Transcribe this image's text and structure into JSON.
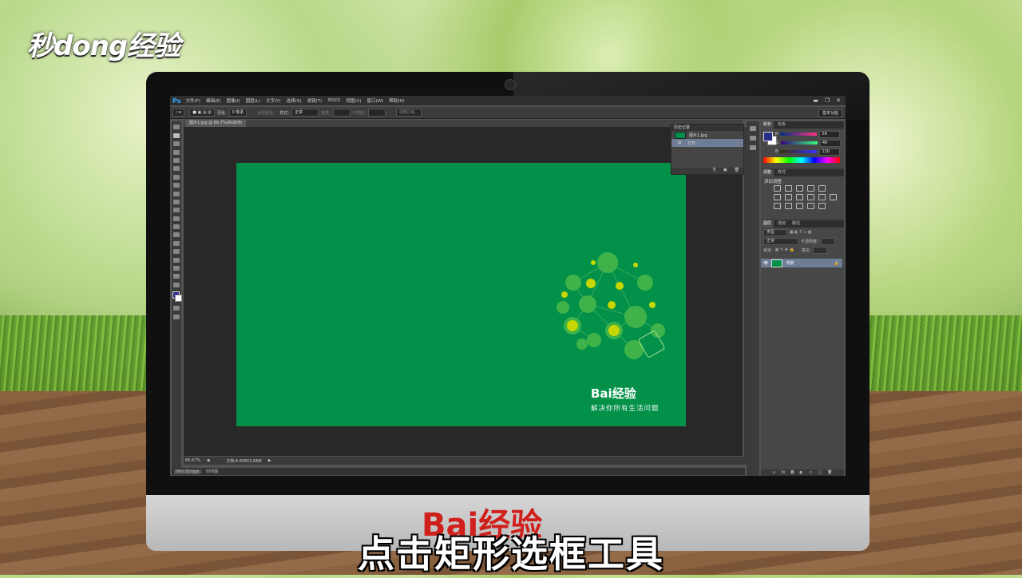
{
  "watermark_logo": "秒dong经验",
  "subtitle": "点击矩形选框工具",
  "chin_logo": "Bai经验",
  "photoshop": {
    "app_icon": "Ps",
    "menu": [
      "文件(F)",
      "编辑(E)",
      "图像(I)",
      "图层(L)",
      "文字(Y)",
      "选择(S)",
      "滤镜(T)",
      "3D(D)",
      "视图(V)",
      "窗口(W)",
      "帮助(H)"
    ],
    "window_controls": [
      "▬",
      "❐",
      "✕"
    ],
    "options": {
      "feather_label": "羽化:",
      "feather_value": "0 像素",
      "antialias": "消除锯齿",
      "style_label": "样式:",
      "style_value": "正常",
      "width_label": "宽度:",
      "height_label": "高度:",
      "refine_edge": "调整边缘..."
    },
    "workspace": "基本功能",
    "doc_tab": "图片1.jpg @ 66.7%(RGB/8)",
    "status": {
      "zoom": "66.67%",
      "doc_size": "文档:6.80M/3.66M"
    },
    "bottom_tabs": [
      "Mini Bridge",
      "时间轴"
    ],
    "history": {
      "title": "历史记录",
      "items": [
        "图片1.jpg",
        "打开"
      ]
    },
    "color_panel": {
      "tabs": [
        "颜色",
        "色板"
      ],
      "rows": [
        {
          "label": "R",
          "value": "56"
        },
        {
          "label": "G",
          "value": "48"
        },
        {
          "label": "B",
          "value": "130"
        }
      ],
      "fg_color": "#2a2c8c",
      "bg_color": "#ffffff"
    },
    "adjust_panel": {
      "tabs": [
        "调整",
        "样式"
      ],
      "title": "添加调整"
    },
    "layers_panel": {
      "tabs": [
        "图层",
        "通道",
        "路径"
      ],
      "kind": "类型",
      "blend": "正常",
      "opacity_label": "不透明度:",
      "lock_label": "锁定:",
      "fill_label": "填充:",
      "layer_name": "背景"
    },
    "canvas_bg": "#03914a"
  },
  "artwork": {
    "brand": "Bai经验",
    "slogan": "解决你所有生活问题"
  }
}
